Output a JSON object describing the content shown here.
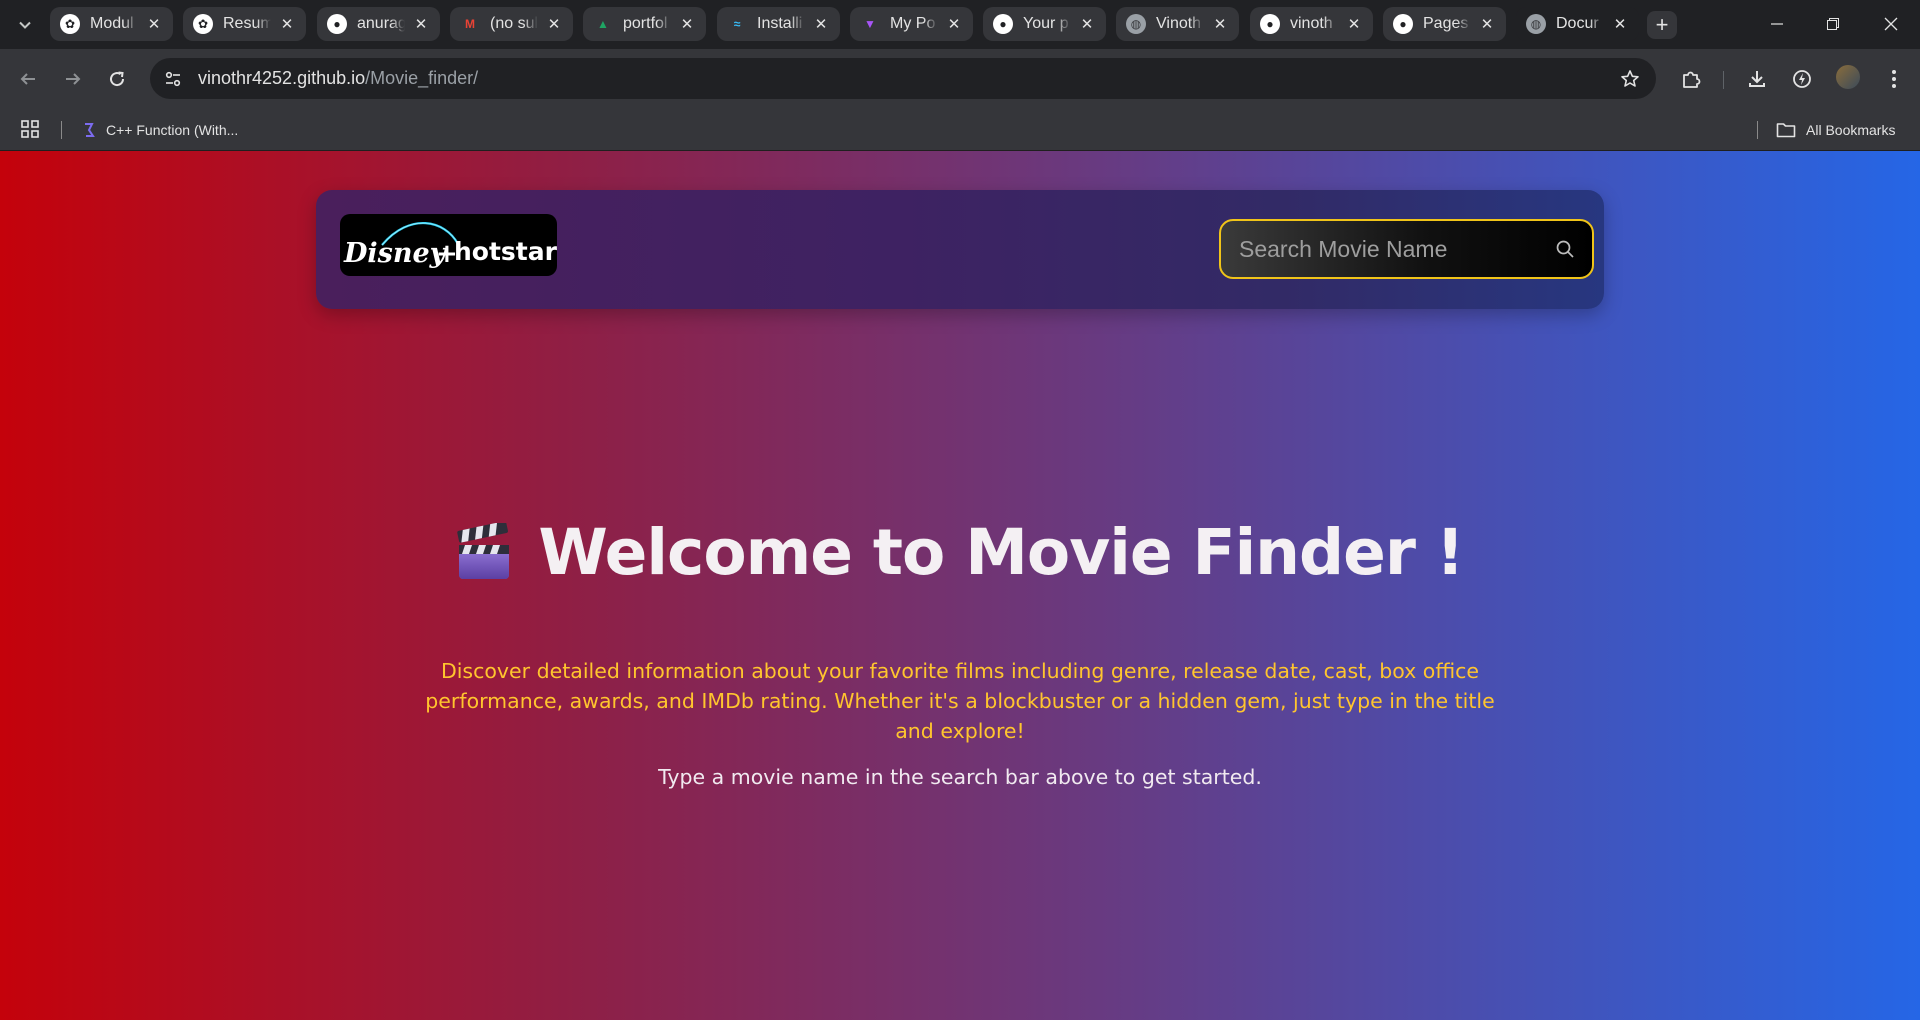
{
  "browser": {
    "tabs": [
      {
        "title": "Modul",
        "icon": "openai-icon",
        "active": false
      },
      {
        "title": "Resum",
        "icon": "openai-icon",
        "active": false
      },
      {
        "title": "anurag",
        "icon": "github-icon",
        "active": false
      },
      {
        "title": "(no sul",
        "icon": "gmail-icon",
        "active": false
      },
      {
        "title": "portfol",
        "icon": "google-drive-icon",
        "active": false
      },
      {
        "title": "Installi",
        "icon": "tailwind-icon",
        "active": false
      },
      {
        "title": "My Po",
        "icon": "vite-icon",
        "active": false
      },
      {
        "title": "Your p",
        "icon": "github-icon",
        "active": false
      },
      {
        "title": "Vinoth",
        "icon": "globe-icon",
        "active": false
      },
      {
        "title": "vinoth",
        "icon": "github-icon",
        "active": false
      },
      {
        "title": "Pages",
        "icon": "github-icon",
        "active": false
      },
      {
        "title": "Docur",
        "icon": "globe-icon",
        "active": true
      }
    ],
    "url_host": "vinothr4252.github.io",
    "url_path": "/Movie_finder/",
    "bookmarks": [
      {
        "label": "C++ Function (With...",
        "icon": "perplexity-icon"
      }
    ],
    "all_bookmarks_label": "All Bookmarks"
  },
  "site": {
    "logo_text": "Disney+ hotstar",
    "search_placeholder": "Search Movie Name"
  },
  "hero": {
    "title": "Welcome to Movie Finder !",
    "emoji_icon": "clapperboard-icon",
    "description": "Discover detailed information about your favorite films including genre, release date, cast, box office performance, awards, and IMDb rating. Whether it's a blockbuster or a hidden gem, just type in the title and explore!",
    "hint": "Type a movie name in the search bar above to get started."
  },
  "colors": {
    "gradient_left": "#c4020b",
    "gradient_right": "#2566e6",
    "description_text": "#ffc52e",
    "search_border": "#f0c419"
  }
}
